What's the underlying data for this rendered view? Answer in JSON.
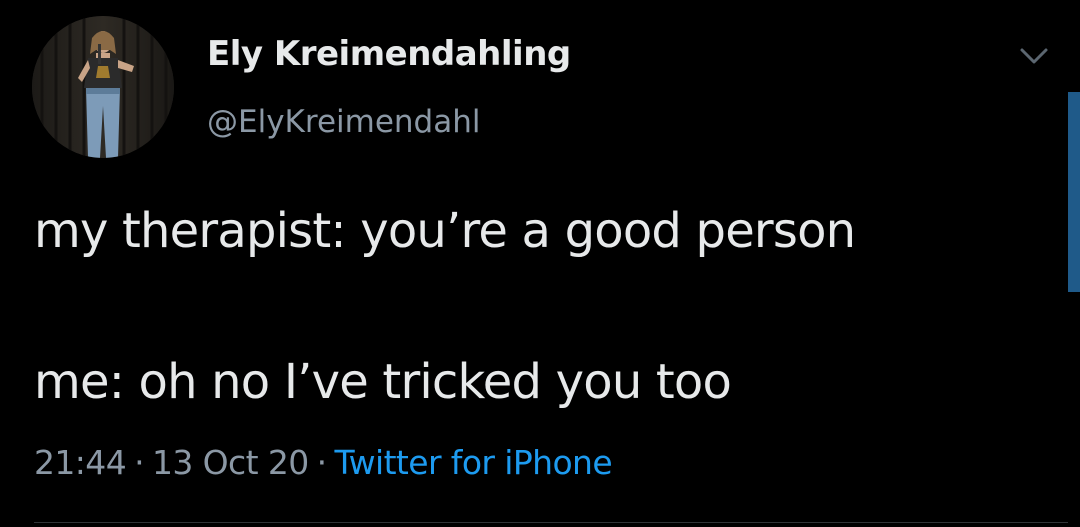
{
  "user": {
    "display_name": "Ely Kreimendahling",
    "handle": "@ElyKreimendahl"
  },
  "tweet": {
    "line1": "my therapist: you’re a good person",
    "line2": "me: oh no I’ve tricked you too"
  },
  "meta": {
    "time": "21:44",
    "separator": "·",
    "date": "13 Oct 20",
    "source": "Twitter for iPhone"
  },
  "icons": {
    "menu": "chevron-down-icon"
  },
  "colors": {
    "background": "#000000",
    "text": "#e7e9ea",
    "secondary": "#8b98a5",
    "link": "#1d9bf0"
  }
}
